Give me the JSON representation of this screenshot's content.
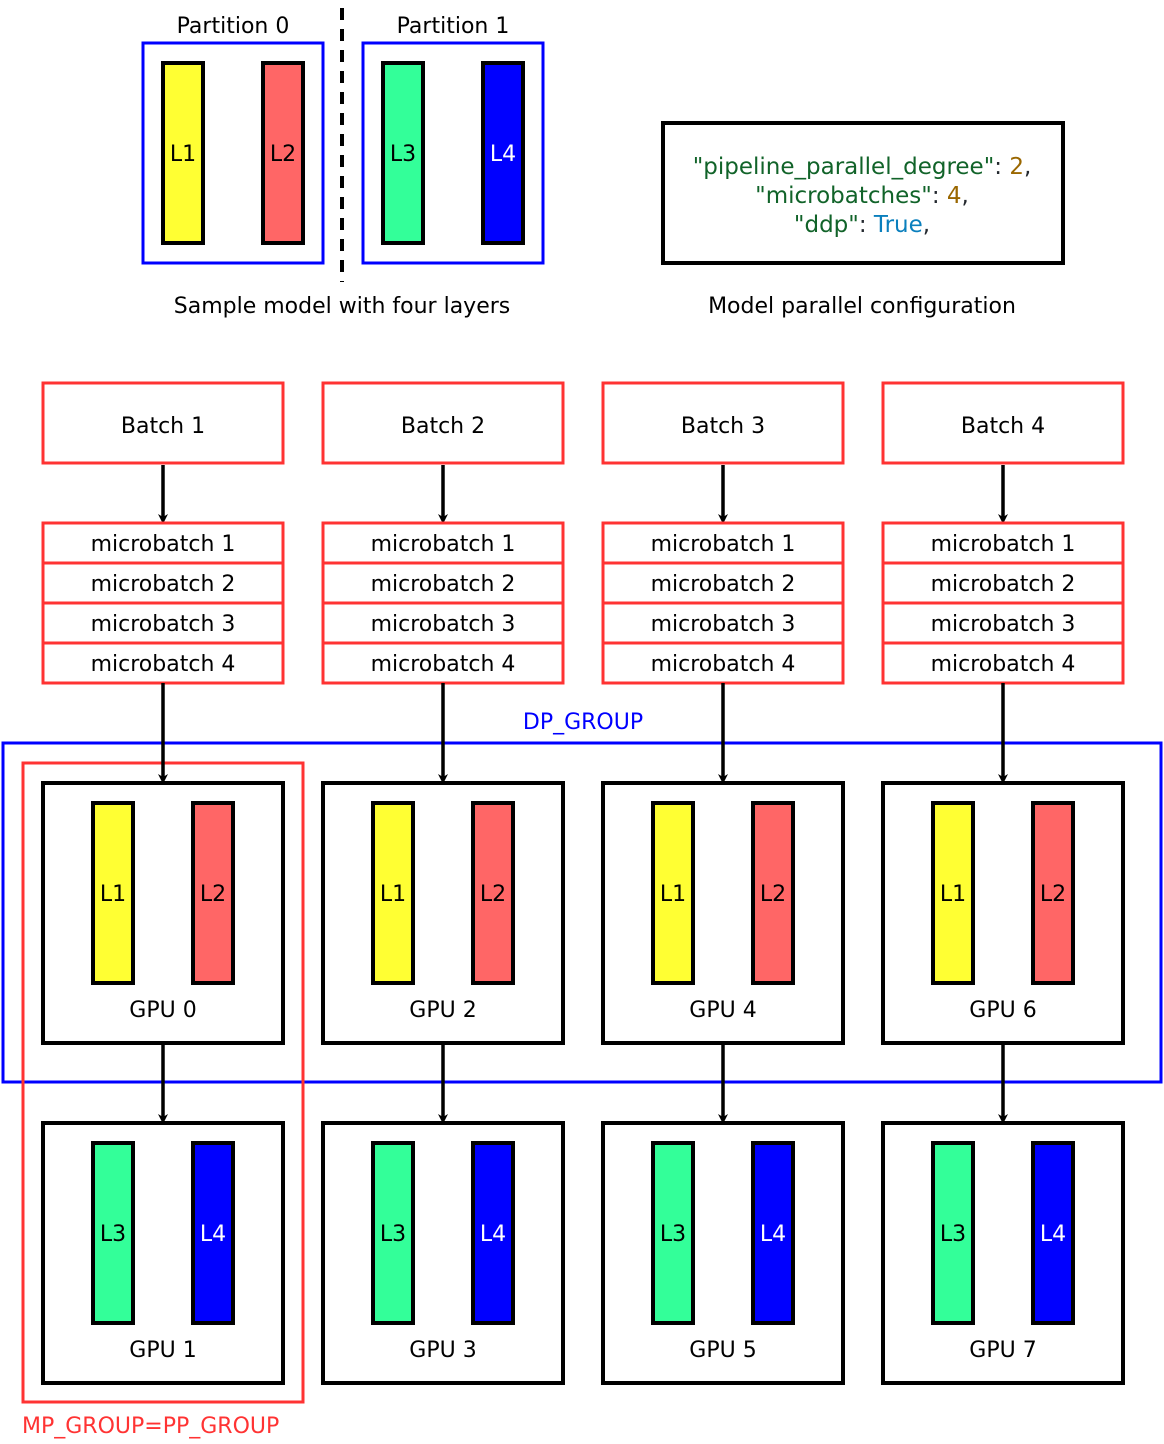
{
  "colors": {
    "layer_L1": "#ffff33",
    "layer_L2": "#ff6666",
    "layer_L3": "#33ff99",
    "layer_L4": "#0000ff",
    "partition_border": "#0000ff",
    "batch_border": "#ff3333",
    "dp_group": "#0000ff",
    "mp_group": "#ff3333",
    "code_key": "#116329",
    "code_number": "#9a6700",
    "code_bool": "#0a7fbd",
    "code_punct": "#24292f"
  },
  "top": {
    "partitions": [
      {
        "label": "Partition 0",
        "layers": [
          {
            "name": "L1",
            "color_key": "layer_L1"
          },
          {
            "name": "L2",
            "color_key": "layer_L2"
          }
        ]
      },
      {
        "label": "Partition 1",
        "layers": [
          {
            "name": "L3",
            "color_key": "layer_L3"
          },
          {
            "name": "L4",
            "color_key": "layer_L4"
          }
        ]
      }
    ],
    "model_caption": "Sample model with four layers",
    "config_caption": "Model parallel configuration",
    "config_lines": [
      {
        "key": "\"pipeline_parallel_degree\"",
        "sep": ": ",
        "value": "2",
        "value_type": "number",
        "trail": ","
      },
      {
        "key": "\"microbatches\"",
        "sep": ": ",
        "value": "4",
        "value_type": "number",
        "trail": ","
      },
      {
        "key": "\"ddp\"",
        "sep": ": ",
        "value": "True",
        "value_type": "bool",
        "trail": ","
      }
    ]
  },
  "columns": [
    {
      "batch": "Batch 1",
      "microbatches": [
        "microbatch 1",
        "microbatch 2",
        "microbatch 3",
        "microbatch 4"
      ],
      "gpus": [
        {
          "label": "GPU 0",
          "layers": [
            "L1",
            "L2"
          ]
        },
        {
          "label": "GPU 1",
          "layers": [
            "L3",
            "L4"
          ]
        }
      ]
    },
    {
      "batch": "Batch 2",
      "microbatches": [
        "microbatch 1",
        "microbatch 2",
        "microbatch 3",
        "microbatch 4"
      ],
      "gpus": [
        {
          "label": "GPU 2",
          "layers": [
            "L1",
            "L2"
          ]
        },
        {
          "label": "GPU 3",
          "layers": [
            "L3",
            "L4"
          ]
        }
      ]
    },
    {
      "batch": "Batch 3",
      "microbatches": [
        "microbatch 1",
        "microbatch 2",
        "microbatch 3",
        "microbatch 4"
      ],
      "gpus": [
        {
          "label": "GPU 4",
          "layers": [
            "L1",
            "L2"
          ]
        },
        {
          "label": "GPU 5",
          "layers": [
            "L3",
            "L4"
          ]
        }
      ]
    },
    {
      "batch": "Batch 4",
      "microbatches": [
        "microbatch 1",
        "microbatch 2",
        "microbatch 3",
        "microbatch 4"
      ],
      "gpus": [
        {
          "label": "GPU 6",
          "layers": [
            "L1",
            "L2"
          ]
        },
        {
          "label": "GPU 7",
          "layers": [
            "L3",
            "L4"
          ]
        }
      ]
    }
  ],
  "groups": {
    "dp_label": "DP_GROUP",
    "mp_label": "MP_GROUP=PP_GROUP"
  }
}
